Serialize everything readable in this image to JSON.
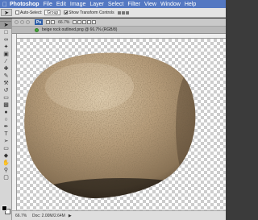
{
  "menubar": {
    "apple_icon": "apple-icon",
    "app_name": "Photoshop",
    "items": [
      "File",
      "Edit",
      "Image",
      "Layer",
      "Select",
      "Filter",
      "View",
      "Window",
      "Help"
    ]
  },
  "options": {
    "auto_select_label": "Auto-Select:",
    "auto_select_checked": false,
    "auto_select_value": "Group",
    "show_transform_label": "Show Transform Controls",
    "show_transform_checked": true
  },
  "appbar": {
    "ps_badge": "Ps",
    "zoom": "66.7%"
  },
  "document": {
    "title": "beige rock outlined.png @ 66.7% (RGB/8)"
  },
  "status": {
    "zoom": "66.7%",
    "doc_size": "Doc: 2.00M/2.64M"
  },
  "colors": {
    "menubar": "#5478c2",
    "close_button": "#44a836",
    "minimize_button": "#e0b12e",
    "rock_base": "#b09878",
    "foreground": "#000000",
    "background": "#ffffff"
  }
}
